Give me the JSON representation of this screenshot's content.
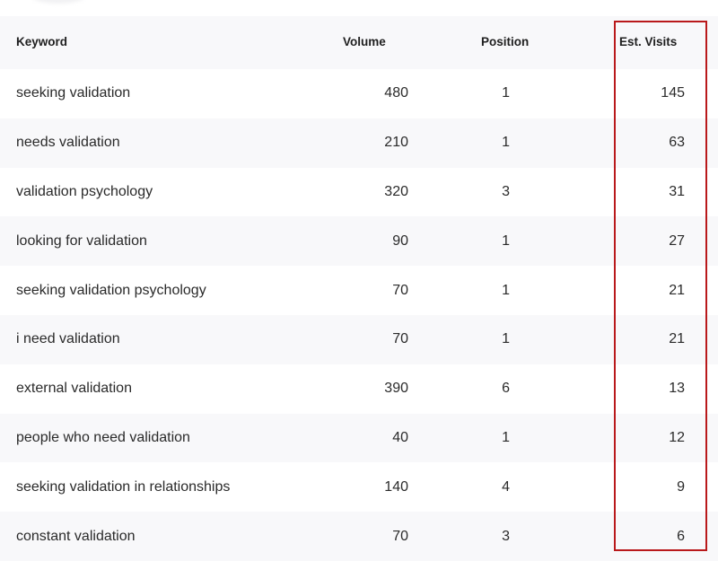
{
  "table": {
    "columns": {
      "keyword": "Keyword",
      "volume": "Volume",
      "position": "Position",
      "visits": "Est. Visits"
    },
    "rows": [
      {
        "keyword": "seeking validation",
        "volume": "480",
        "position": "1",
        "visits": "145"
      },
      {
        "keyword": "needs validation",
        "volume": "210",
        "position": "1",
        "visits": "63"
      },
      {
        "keyword": "validation psychology",
        "volume": "320",
        "position": "3",
        "visits": "31"
      },
      {
        "keyword": "looking for validation",
        "volume": "90",
        "position": "1",
        "visits": "27"
      },
      {
        "keyword": "seeking validation psychology",
        "volume": "70",
        "position": "1",
        "visits": "21"
      },
      {
        "keyword": "i need validation",
        "volume": "70",
        "position": "1",
        "visits": "21"
      },
      {
        "keyword": "external validation",
        "volume": "390",
        "position": "6",
        "visits": "13"
      },
      {
        "keyword": "people who need validation",
        "volume": "40",
        "position": "1",
        "visits": "12"
      },
      {
        "keyword": "seeking validation in relationships",
        "volume": "140",
        "position": "4",
        "visits": "9"
      },
      {
        "keyword": "constant validation",
        "volume": "70",
        "position": "3",
        "visits": "6"
      }
    ]
  },
  "highlight": {
    "color": "#b9191b",
    "column": "visits"
  }
}
